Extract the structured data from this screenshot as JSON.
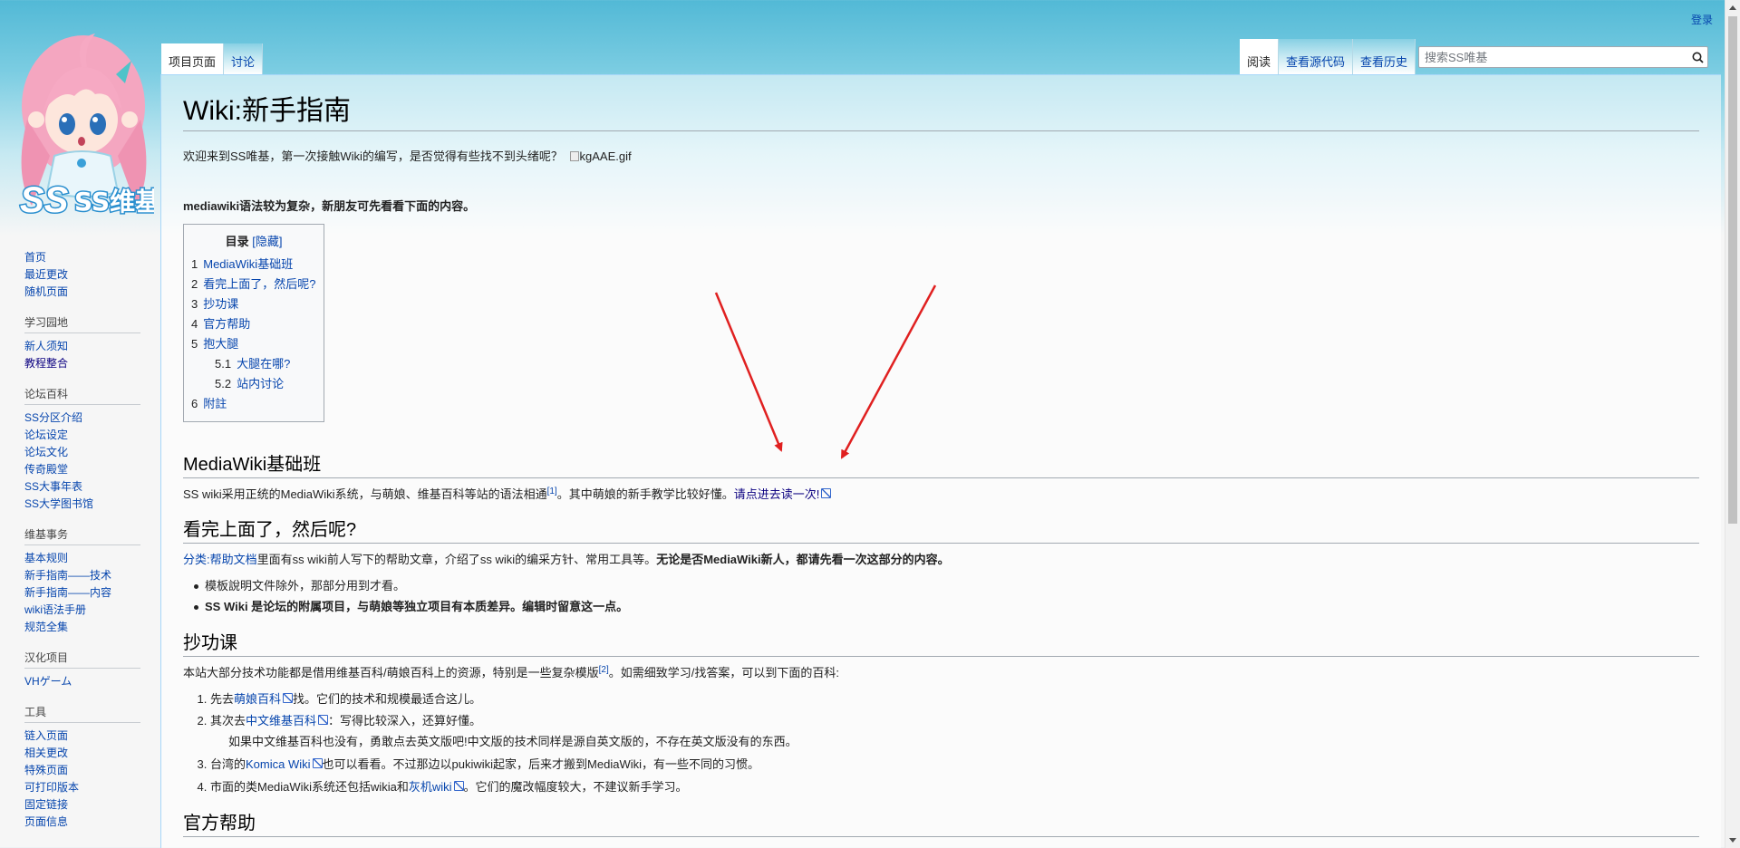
{
  "personal": {
    "login": "登录"
  },
  "tabs_left": [
    "项目页面",
    "讨论"
  ],
  "tabs_right": [
    "阅读",
    "查看源代码",
    "查看历史"
  ],
  "search": {
    "placeholder": "搜索SS唯基"
  },
  "logo": {
    "text": "SS维基"
  },
  "sidebar": {
    "main": [
      "首页",
      "最近更改",
      "随机页面"
    ],
    "portals": [
      {
        "title": "学习园地",
        "items": [
          "新人须知",
          "教程整合"
        ]
      },
      {
        "title": "论坛百科",
        "items": [
          "SS分区介绍",
          "论坛设定",
          "论坛文化",
          "传奇殿堂",
          "SS大事年表",
          "SS大学图书馆"
        ]
      },
      {
        "title": "维基事务",
        "items": [
          "基本规则",
          "新手指南——技术",
          "新手指南——内容",
          "wiki语法手册",
          "规范全集"
        ]
      },
      {
        "title": "汉化项目",
        "items": [
          "VHゲーム"
        ]
      },
      {
        "title": "工具",
        "items": [
          "链入页面",
          "相关更改",
          "特殊页面",
          "可打印版本",
          "固定链接",
          "页面信息"
        ]
      }
    ]
  },
  "page": {
    "title": "Wiki:新手指南",
    "intro_text": "欢迎来到SS唯基，第一次接触Wiki的编写，是否觉得有些找不到头绪呢？",
    "intro_img_alt": "kgAAE.gif",
    "bold_note": "mediawiki语法较为复杂，新朋友可先看看下面的内容。"
  },
  "toc": {
    "title": "目录",
    "hide_label": "[隐藏]",
    "items": [
      {
        "num": "1",
        "label": "MediaWiki基础班"
      },
      {
        "num": "2",
        "label": "看完上面了，然后呢?"
      },
      {
        "num": "3",
        "label": "抄功课"
      },
      {
        "num": "4",
        "label": "官方帮助"
      },
      {
        "num": "5",
        "label": "抱大腿"
      },
      {
        "num": "5.1",
        "label": "大腿在哪?"
      },
      {
        "num": "5.2",
        "label": "站内讨论"
      },
      {
        "num": "6",
        "label": "附註"
      }
    ]
  },
  "sections": {
    "s1": {
      "heading": "MediaWiki基础班",
      "text1": "SS wiki采用正统的MediaWiki系统，与萌娘、维基百科等站的语法相通",
      "ref": "[1]",
      "text2": "。其中萌娘的新手教学比较好懂。",
      "link": "请点进去读一次!"
    },
    "s2": {
      "heading": "看完上面了，然后呢?",
      "link": "分类:帮助文档",
      "text1": "里面有ss wiki前人写下的帮助文章，介绍了ss wiki的编采方针、常用工具等。",
      "bold": "无论是否MediaWiki新人，都请先看一次这部分的内容。",
      "bullet1": "模板說明文件除外，那部分用到才看。",
      "bullet2": "SS Wiki 是论坛的附属项目，与萌娘等独立项目有本质差异。编辑时留意这一点。"
    },
    "s3": {
      "heading": "抄功课",
      "intro1": "本站大部分技术功能都是借用维基百科/萌娘百科上的资源，特别是一些复杂模版",
      "ref": "[2]",
      "intro2": "。如需细致学习/找答案，可以到下面的百科:",
      "li1_pre": "先去",
      "li1_link": "萌娘百科",
      "li1_post": "找。它们的技术和规模最适合这儿。",
      "li2_pre": "其次去",
      "li2_link": "中文维基百科",
      "li2_post": "：写得比较深入，还算好懂。",
      "li2_note": "如果中文维基百科也没有，勇敢点去英文版吧!中文版的技术同样是源自英文版的，不存在英文版没有的东西。",
      "li3_pre": "台湾的",
      "li3_link": "Komica Wiki",
      "li3_post": "也可以看看。不过那边以pukiwiki起家，后来才搬到MediaWiki，有一些不同的习惯。",
      "li4_pre": "市面的类MediaWiki系统还包括wikia和",
      "li4_link": "灰机wiki",
      "li4_post": "。它们的魔改幅度较大，不建议新手学习。"
    },
    "s4": {
      "heading": "官方帮助"
    }
  },
  "colors": {
    "link": "#0645ad",
    "visited": "#0b0080",
    "arrow": "#e02020"
  }
}
